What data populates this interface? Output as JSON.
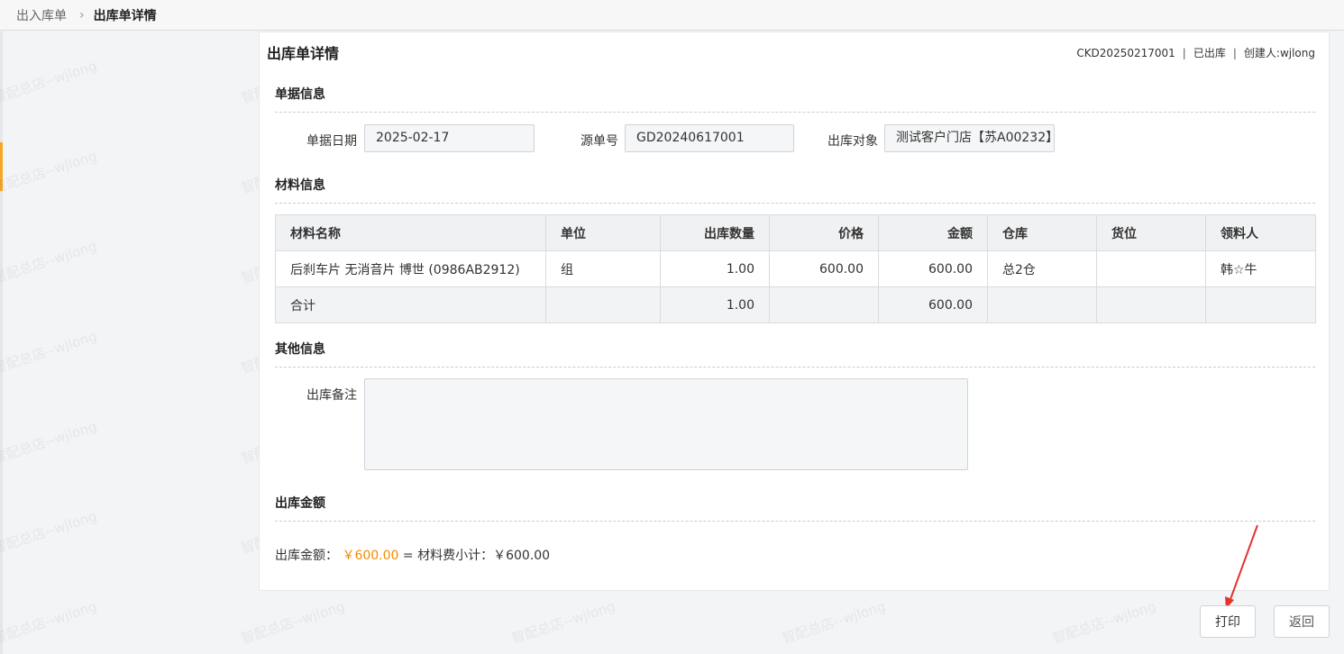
{
  "breadcrumb": {
    "parent": "出入库单",
    "current": "出库单详情"
  },
  "card": {
    "title": "出库单详情",
    "order_no": "CKD20250217001",
    "status": "已出库",
    "creator": "创建人:wjlong"
  },
  "sections": {
    "doc_info": "单据信息",
    "material_info": "材料信息",
    "other_info": "其他信息",
    "amount": "出库金额"
  },
  "doc_info": {
    "date_label": "单据日期",
    "date_value": "2025-02-17",
    "source_label": "源单号",
    "source_value": "GD20240617001",
    "target_label": "出库对象",
    "target_value": "测试客户门店【苏A00232】"
  },
  "table": {
    "headers": [
      "材料名称",
      "单位",
      "出库数量",
      "价格",
      "金额",
      "仓库",
      "货位",
      "领料人"
    ],
    "rows": [
      [
        "后刹车片 无消音片 博世 (0986AB2912)",
        "组",
        "1.00",
        "600.00",
        "600.00",
        "总2仓",
        "",
        "韩☆牛"
      ]
    ],
    "total": [
      "合计",
      "",
      "1.00",
      "",
      "600.00",
      "",
      "",
      ""
    ]
  },
  "other_info": {
    "remark_label": "出库备注",
    "remark_value": ""
  },
  "amount": {
    "label": "出库金额：",
    "total": "￥600.00",
    "equals": " = 材料费小计：",
    "subtotal": "￥600.00"
  },
  "buttons": {
    "print": "打印",
    "back": "返回"
  },
  "watermark_text": "智配总店--wjlong",
  "colors": {
    "accent": "#f5a623",
    "link": "#1f6fd1",
    "amount": "#f08c00",
    "arrow": "#e5322d"
  }
}
